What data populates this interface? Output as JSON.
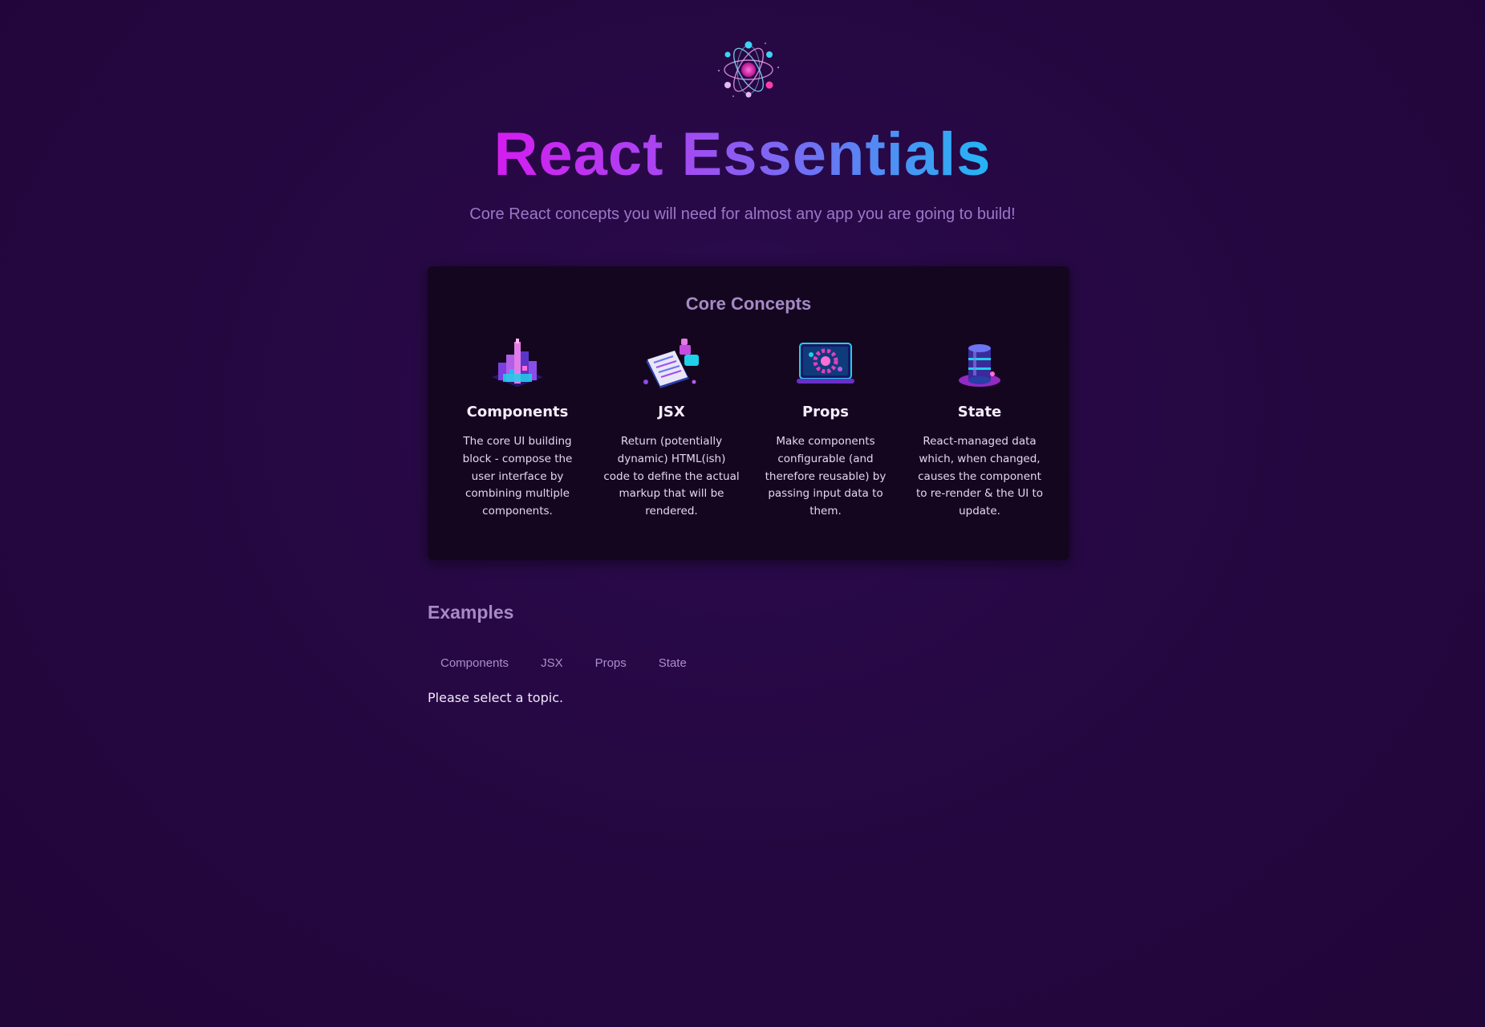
{
  "header": {
    "title": "React Essentials",
    "subtitle": "Core React concepts you will need for almost any app you are going to build!",
    "logo_icon": "react-atom-icon"
  },
  "core_concepts": {
    "title": "Core Concepts",
    "items": [
      {
        "icon": "components-blocks-icon",
        "title": "Components",
        "description": "The core UI building block - compose the user interface by combining multiple components."
      },
      {
        "icon": "jsx-document-icon",
        "title": "JSX",
        "description": "Return (potentially dynamic) HTML(ish) code to define the actual markup that will be rendered."
      },
      {
        "icon": "props-config-icon",
        "title": "Props",
        "description": "Make components configurable (and therefore reusable) by passing input data to them."
      },
      {
        "icon": "state-database-icon",
        "title": "State",
        "description": "React-managed data which, when changed, causes the component to re-render & the UI to update."
      }
    ]
  },
  "examples": {
    "title": "Examples",
    "tabs": [
      "Components",
      "JSX",
      "Props",
      "State"
    ],
    "empty_message": "Please select a topic."
  },
  "colors": {
    "background": "#24073f",
    "panel": "#150620",
    "title_gradient_start": "#d51cf0",
    "title_gradient_end": "#23b6f5",
    "muted_heading": "#a58ac4"
  }
}
